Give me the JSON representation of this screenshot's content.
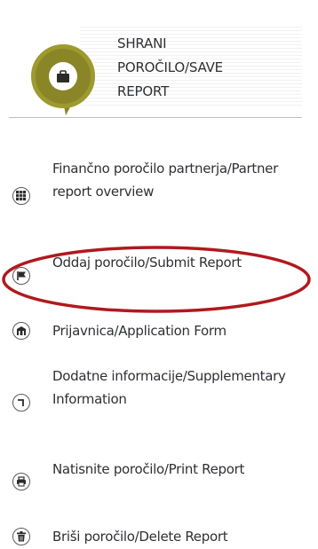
{
  "save": {
    "label_line1": "SHRANI",
    "label_line2": "POROČILO/SAVE",
    "label_line3": "REPORT",
    "icon": "briefcase-icon",
    "accent_color": "#8a8628"
  },
  "menu": {
    "items": [
      {
        "label": "Finančno poročilo partnerja/Partner report overview",
        "icon": "grid-icon"
      },
      {
        "label": "Oddaj poročilo/Submit Report",
        "icon": "flag-icon"
      },
      {
        "label": "Prijavnica/Application Form",
        "icon": "building-icon"
      },
      {
        "label": "Dodatne informacije/Supplementary Information",
        "icon": "return-arrow-icon"
      },
      {
        "label": "Natisnite poročilo/Print Report",
        "icon": "printer-icon"
      },
      {
        "label": "Briši poročilo/Delete Report",
        "icon": "trash-icon"
      }
    ]
  },
  "highlight_color": "#b0191e"
}
